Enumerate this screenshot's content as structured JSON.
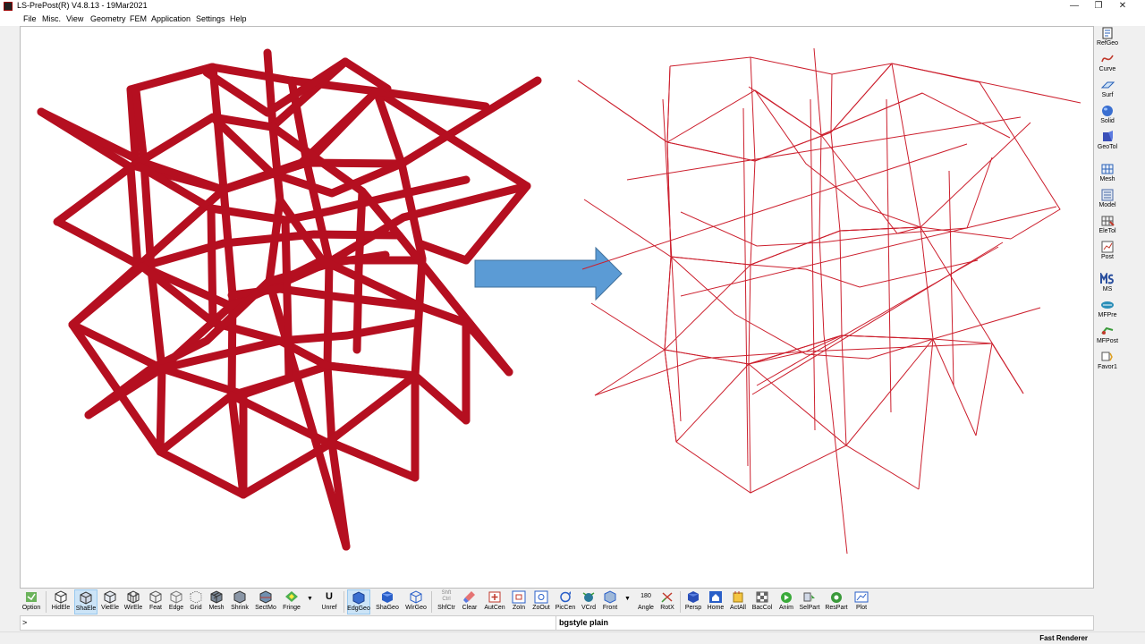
{
  "window": {
    "title": "LS-PrePost(R) V4.8.13 - 19Mar2021",
    "controls": {
      "minimize": "—",
      "maximize": "❐",
      "close": "✕"
    }
  },
  "menu": [
    "File",
    "Misc.",
    "View",
    "Geometry",
    "FEM",
    "Application",
    "Settings",
    "Help"
  ],
  "right_toolbar": [
    {
      "label": "RefGeo",
      "icon": "refgeo-icon"
    },
    {
      "label": "Curve",
      "icon": "curve-icon"
    },
    {
      "label": "Surf",
      "icon": "surface-icon"
    },
    {
      "label": "Solid",
      "icon": "solid-icon"
    },
    {
      "label": "GeoTol",
      "icon": "geotol-icon"
    },
    {
      "label": "Mesh",
      "icon": "mesh-icon"
    },
    {
      "label": "Model",
      "icon": "model-icon"
    },
    {
      "label": "EleTol",
      "icon": "eletol-icon"
    },
    {
      "label": "Post",
      "icon": "post-icon"
    },
    {
      "label": "MS",
      "icon": "ms-icon"
    },
    {
      "label": "MFPre",
      "icon": "mfpre-icon"
    },
    {
      "label": "MFPost",
      "icon": "mfpost-icon"
    },
    {
      "label": "Favor1",
      "icon": "favorite-icon"
    }
  ],
  "bottom_toolbar": [
    {
      "label": "Option",
      "icon": "option-icon"
    },
    {
      "label": "HidEle",
      "icon": "hidden-element-icon"
    },
    {
      "label": "ShaEle",
      "icon": "shaded-element-icon",
      "active": true
    },
    {
      "label": "VieEle",
      "icon": "view-element-icon"
    },
    {
      "label": "WirEle",
      "icon": "wire-element-icon"
    },
    {
      "label": "Feat",
      "icon": "feature-icon"
    },
    {
      "label": "Edge",
      "icon": "edge-icon"
    },
    {
      "label": "Grid",
      "icon": "grid-icon"
    },
    {
      "label": "Mesh",
      "icon": "mesh-view-icon"
    },
    {
      "label": "Shrink",
      "icon": "shrink-icon"
    },
    {
      "label": "SectMo",
      "icon": "section-mode-icon"
    },
    {
      "label": "Fringe",
      "icon": "fringe-icon"
    },
    {
      "label": "Unref",
      "icon": "unref-icon"
    },
    {
      "label": "EdgGeo",
      "icon": "edge-geometry-icon",
      "active": true
    },
    {
      "label": "ShaGeo",
      "icon": "shaded-geometry-icon"
    },
    {
      "label": "WirGeo",
      "icon": "wire-geometry-icon"
    },
    {
      "label": "ShfCtr",
      "icon": "shift-ctrl-icon"
    },
    {
      "label": "Clear",
      "icon": "clear-icon"
    },
    {
      "label": "AutCen",
      "icon": "auto-center-icon"
    },
    {
      "label": "ZoIn",
      "icon": "zoom-in-icon"
    },
    {
      "label": "ZoOut",
      "icon": "zoom-out-icon"
    },
    {
      "label": "PicCen",
      "icon": "pick-center-icon"
    },
    {
      "label": "VCrd",
      "icon": "view-coordinate-icon"
    },
    {
      "label": "Front",
      "icon": "front-view-icon"
    },
    {
      "label": "Angle",
      "icon": "angle-icon"
    },
    {
      "label": "RotX",
      "icon": "rotate-x-icon"
    },
    {
      "label": "Persp",
      "icon": "perspective-icon"
    },
    {
      "label": "Home",
      "icon": "home-icon"
    },
    {
      "label": "ActAll",
      "icon": "activate-all-icon"
    },
    {
      "label": "BacCol",
      "icon": "background-color-icon"
    },
    {
      "label": "Anim",
      "icon": "animate-icon"
    },
    {
      "label": "SelPart",
      "icon": "select-part-icon"
    },
    {
      "label": "ResPart",
      "icon": "reset-part-icon"
    },
    {
      "label": "Plot",
      "icon": "plot-icon"
    }
  ],
  "toolbar_extra": {
    "shift_text": "Shft",
    "ctrl_text": "Ctrl",
    "angle_value": "180",
    "unref_glyph": "U"
  },
  "command": {
    "prompt": ">",
    "output": "bgstyle plain"
  },
  "status": {
    "renderer": "Fast Renderer"
  },
  "colors": {
    "lattice_shaded": "#b50f20",
    "lattice_wire": "#cc1f2d",
    "arrow_fill": "#5b9bd5",
    "arrow_stroke": "#41719c"
  }
}
